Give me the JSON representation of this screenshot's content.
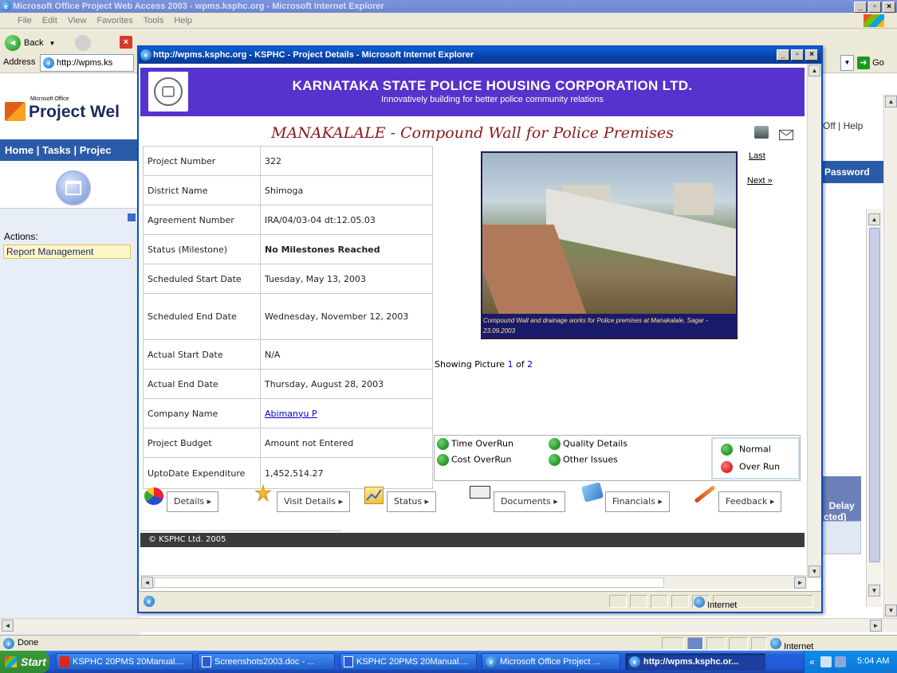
{
  "main_window": {
    "title": "Microsoft Office Project Web Access 2003 - wpms.ksphc.org - Microsoft Internet Explorer",
    "menu": [
      "File",
      "Edit",
      "View",
      "Favorites",
      "Tools",
      "Help"
    ],
    "back_label": "Back",
    "address_label": "Address",
    "address_value": "http://wpms.ks",
    "go_label": "Go",
    "pwa_brand_small": "Microsoft Office",
    "pwa_brand": "Project Wel",
    "nav_text": "Home | Tasks | Projec",
    "right_links": "Off | Help",
    "right_nav": "Password",
    "actions_label": "Actions:",
    "report_management": "Report Management",
    "right_table_header": "Delay\ncted)\nays)",
    "status_done": "Done",
    "status_zone": "Internet"
  },
  "popup": {
    "title": "http://wpms.ksphc.org - KSPHC - Project Details - Microsoft Internet Explorer",
    "banner_title": "KARNATAKA STATE POLICE HOUSING CORPORATION LTD.",
    "banner_subtitle": "Innovatively building for better police community relations",
    "project_title": "MANAKALALE - Compound Wall for Police Premises",
    "details": [
      {
        "label": "Project Number",
        "value": "322"
      },
      {
        "label": "District Name",
        "value": "Shimoga"
      },
      {
        "label": "Agreement Number",
        "value": "IRA/04/03-04 dt:12.05.03"
      },
      {
        "label": "Status (Milestone)",
        "value": "No Milestones Reached"
      },
      {
        "label": "Scheduled Start Date",
        "value": "Tuesday, May 13, 2003"
      },
      {
        "label": "Scheduled End Date",
        "value": "Wednesday, November 12, 2003"
      },
      {
        "label": "Actual Start Date",
        "value": "N/A"
      },
      {
        "label": "Actual End Date",
        "value": "Thursday, August 28, 2003"
      },
      {
        "label": "Company Name",
        "value": "Abimanyu P"
      },
      {
        "label": "Project Budget",
        "value": "Amount not Entered"
      },
      {
        "label": "UptoDate Expenditure",
        "value": "1,452,514.27"
      }
    ],
    "last_link": "Last",
    "next_link": "Next »",
    "photo_caption": "Compound Wall and drainage works for Police premises at Manakalale, Sagar - 23.09.2003",
    "showing_prefix": "Showing Picture",
    "showing_current": "1",
    "showing_of": "of",
    "showing_total": "2",
    "legend": {
      "time_overrun": "Time OverRun",
      "cost_overrun": "Cost OverRun",
      "quality_details": "Quality Details",
      "other_issues": "Other Issues",
      "normal": "Normal",
      "over_run": "Over Run"
    },
    "nav_buttons": {
      "details": "Details ▸",
      "visit_details": "Visit Details ▸",
      "status": "Status ▸",
      "documents": "Documents ▸",
      "financials": "Financials ▸",
      "feedback": "Feedback ▸"
    },
    "footer": "© KSPHC Ltd. 2005",
    "status_zone": "Internet"
  },
  "taskbar": {
    "start": "Start",
    "buttons": [
      "KSPHC 20PMS 20Manual....",
      "Screenshots2003.doc - ...",
      "KSPHC 20PMS 20Manual....",
      "Microsoft Office Project ...",
      "http://wpms.ksphc.or..."
    ],
    "time": "5:04 AM"
  },
  "colors": {
    "banner": "#5533cc",
    "title_text": "#8b1a1a",
    "xp_blue": "#0a5fd8"
  }
}
